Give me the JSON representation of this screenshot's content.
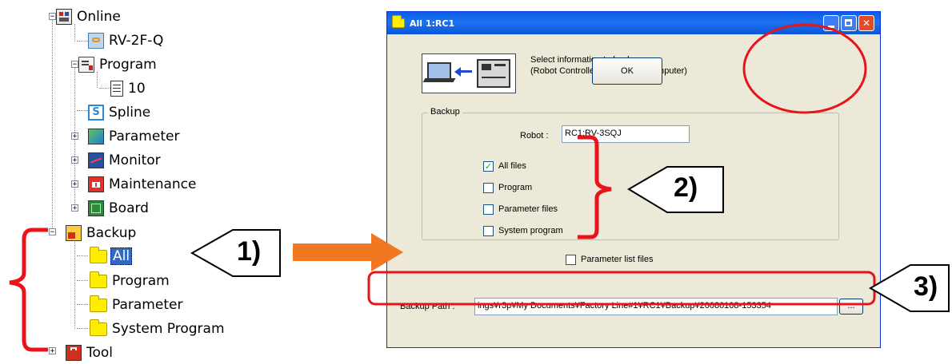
{
  "tree": {
    "items": [
      {
        "label": "Online",
        "icon": "online-icon"
      },
      {
        "label": "RV-2F-Q",
        "icon": "robot-icon"
      },
      {
        "label": "Program",
        "icon": "program-icon"
      },
      {
        "label": "10",
        "icon": "document-icon"
      },
      {
        "label": "Spline",
        "icon": "spline-icon"
      },
      {
        "label": "Parameter",
        "icon": "parameter-icon"
      },
      {
        "label": "Monitor",
        "icon": "monitor-icon"
      },
      {
        "label": "Maintenance",
        "icon": "maintenance-icon"
      },
      {
        "label": "Board",
        "icon": "board-icon"
      },
      {
        "label": "Backup",
        "icon": "backup-icon"
      },
      {
        "label": "All",
        "icon": "folder-icon"
      },
      {
        "label": "Program",
        "icon": "folder-icon"
      },
      {
        "label": "Parameter",
        "icon": "folder-icon"
      },
      {
        "label": "System Program",
        "icon": "folder-icon"
      },
      {
        "label": "Tool",
        "icon": "tool-icon"
      }
    ]
  },
  "dialog": {
    "title": "All 1:RC1",
    "info_line1": "Select information to backup.",
    "info_line2": "(Robot Controller -> Personal computer)",
    "ok_label": "OK",
    "group_label": "Backup",
    "robot_label": "Robot :",
    "robot_value": "RC1:RV-3SQJ",
    "options": [
      {
        "label": "All files",
        "checked": true
      },
      {
        "label": "Program",
        "checked": false
      },
      {
        "label": "Parameter files",
        "checked": false
      },
      {
        "label": "System program",
        "checked": false
      }
    ],
    "param_list_label": "Parameter list files",
    "param_list_checked": false,
    "path_label": "Backup Path :",
    "path_value": "ings¥r3p¥My Documents¥Factory Line#1¥RC1¥Backup¥20080108-153354",
    "browse_label": "..."
  },
  "annotations": {
    "callout1": "1)",
    "callout2": "2)",
    "callout3": "3)"
  },
  "colors": {
    "annotation_red": "#e8141a",
    "arrow_orange": "#f07820",
    "title_blue": "#0a5fe0"
  }
}
